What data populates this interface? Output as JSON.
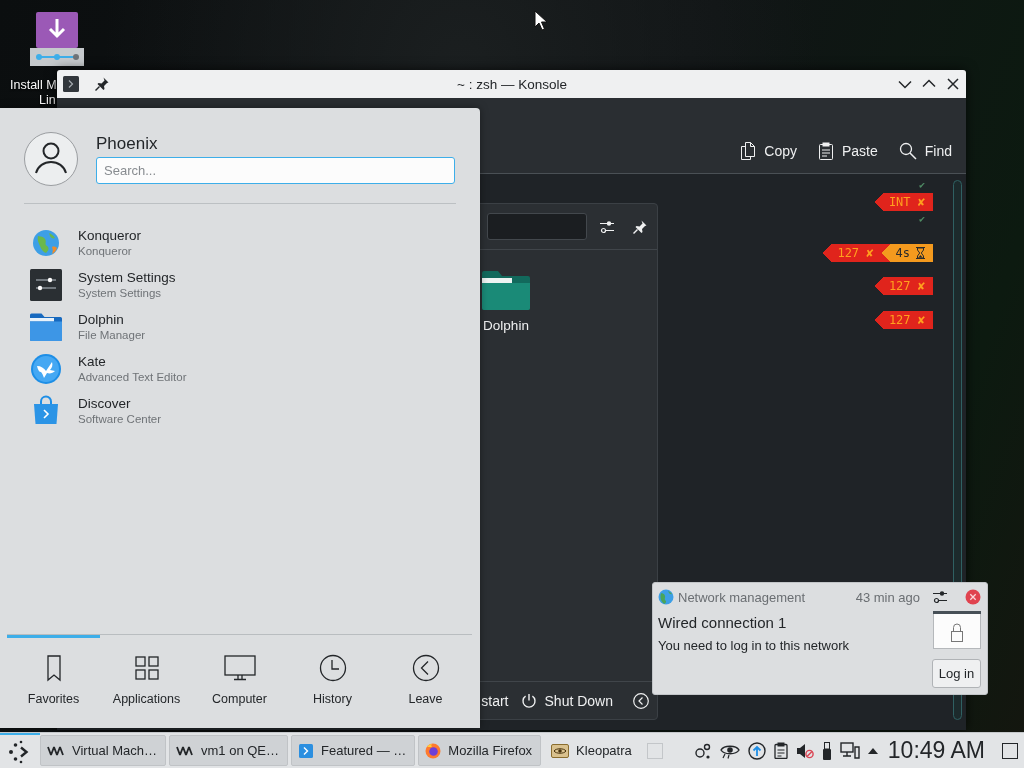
{
  "desktop": {
    "icons": [
      {
        "label_lines": [
          "Install M",
          "Lin"
        ]
      }
    ]
  },
  "konsole": {
    "title": "~ : zsh — Konsole",
    "toolbar": [
      {
        "kind": "copy",
        "label": "Copy"
      },
      {
        "kind": "paste",
        "label": "Paste"
      },
      {
        "kind": "find",
        "label": "Find"
      }
    ],
    "terminal": {
      "lines": [
        {
          "kind": "ok",
          "text": "✔"
        },
        {
          "kind": "prompt",
          "segments": [
            {
              "kind": "error",
              "text": "INT ✘"
            }
          ]
        },
        {
          "kind": "ok",
          "text": "✔"
        },
        {
          "kind": "blank"
        },
        {
          "kind": "prompt",
          "segments": [
            {
              "kind": "error",
              "text": "127 ✘"
            },
            {
              "kind": "duration",
              "text": "4s"
            }
          ]
        },
        {
          "kind": "blank"
        },
        {
          "kind": "prompt",
          "segments": [
            {
              "kind": "error",
              "text": "127 ✘"
            }
          ]
        },
        {
          "kind": "blank"
        },
        {
          "kind": "prompt",
          "segments": [
            {
              "kind": "error",
              "text": "127 ✘"
            }
          ]
        }
      ]
    }
  },
  "app_panel": {
    "apps": [
      {
        "label": "Dolphin"
      }
    ],
    "footer": [
      {
        "kind": "plain",
        "label": "start"
      },
      {
        "kind": "power",
        "label": "Shut Down"
      }
    ]
  },
  "launcher": {
    "user": "Phoenix",
    "search": {
      "placeholder": "Search..."
    },
    "items": [
      {
        "kind": "browser",
        "name": "Konqueror",
        "description": "Konqueror"
      },
      {
        "kind": "settings",
        "name": "System Settings",
        "description": "System Settings"
      },
      {
        "kind": "folder",
        "name": "Dolphin",
        "description": "File Manager"
      },
      {
        "kind": "editor",
        "name": "Kate",
        "description": "Advanced Text Editor"
      },
      {
        "kind": "store",
        "name": "Discover",
        "description": "Software Center"
      }
    ],
    "tabs": [
      {
        "kind": "bookmark",
        "label": "Favorites",
        "selected": true
      },
      {
        "kind": "grid",
        "label": "Applications",
        "selected": false
      },
      {
        "kind": "monitor",
        "label": "Computer",
        "selected": false
      },
      {
        "kind": "clock",
        "label": "History",
        "selected": false
      },
      {
        "kind": "back",
        "label": "Leave",
        "selected": false
      }
    ]
  },
  "notification": {
    "app": "Network management",
    "time": "43 min ago",
    "title": "Wired connection 1",
    "body": "You need to log in to this network",
    "action": "Log in"
  },
  "taskbar": {
    "menu_button": {
      "active": true
    },
    "tasks": [
      {
        "kind": "vm",
        "label": "Virtual Mach…",
        "minimized": false
      },
      {
        "kind": "vm",
        "label": "vm1 on QE…",
        "minimized": false
      },
      {
        "kind": "store",
        "label": "Featured — …",
        "minimized": false
      },
      {
        "kind": "firefox",
        "label": "Mozilla Firefox",
        "minimized": false
      },
      {
        "kind": "kleopatra",
        "label": "Kleopatra",
        "minimized": true
      }
    ],
    "tray": {
      "volume_muted": true
    },
    "clock": "10:49 AM"
  }
}
